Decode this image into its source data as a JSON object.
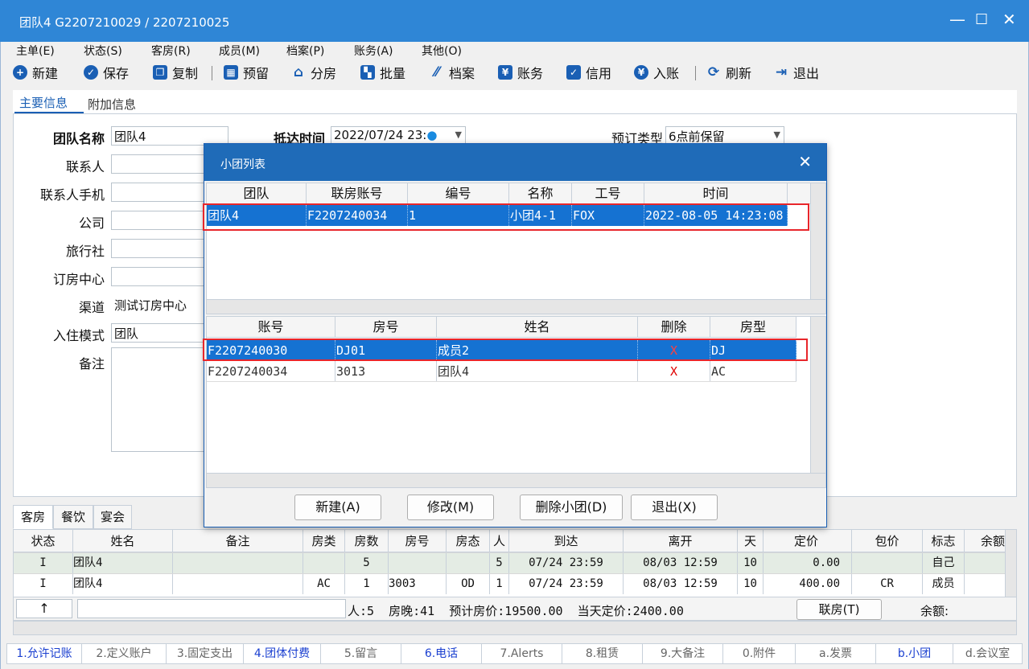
{
  "window": {
    "title": "团队4 G2207210029 / 2207210025",
    "controls": [
      "—",
      "☐",
      "✕"
    ]
  },
  "menu": [
    "主单(E)",
    "状态(S)",
    "客房(R)",
    "成员(M)",
    "档案(P)",
    "账务(A)",
    "其他(O)"
  ],
  "toolbar": {
    "new": "新建",
    "save": "保存",
    "copy": "复制",
    "reserve": "预留",
    "assign": "分房",
    "batch": "批量",
    "profile": "档案",
    "accounts": "账务",
    "credit": "信用",
    "post": "入账",
    "refresh": "刷新",
    "exit": "退出"
  },
  "tabs": {
    "main": "主要信息",
    "extra": "附加信息"
  },
  "form": {
    "group_name_label": "团队名称",
    "group_name": "团队4",
    "arrival_label": "抵达时间",
    "arrival": "2022/07/24 23:",
    "booking_type_label": "预订类型",
    "booking_type": "6点前保留",
    "contact_label": "联系人",
    "contact": "",
    "contact_phone_label": "联系人手机",
    "contact_phone": "",
    "company_label": "公司",
    "company": "",
    "agency_label": "旅行社",
    "agency": "",
    "booking_center_label": "订房中心",
    "booking_center": "",
    "channel_label": "渠道",
    "channel": "测试订房中心",
    "checkin_mode_label": "入住模式",
    "checkin_mode": "团队",
    "remark_label": "备注",
    "remark": ""
  },
  "dialog": {
    "title": "小团列表",
    "close": "✕",
    "top_headers": [
      "团队",
      "联房账号",
      "编号",
      "名称",
      "工号",
      "时间"
    ],
    "top_rows": [
      {
        "group": "团队4",
        "linked_account": "F2207240034",
        "number": "1",
        "name": "小团4-1",
        "staff_id": "FOX",
        "time": "2022-08-05 14:23:08"
      }
    ],
    "bottom_headers": [
      "账号",
      "房号",
      "姓名",
      "删除",
      "房型"
    ],
    "bottom_rows": [
      {
        "account": "F2207240030",
        "room": "DJ01",
        "name": "成员2",
        "delete": "X",
        "room_type": "DJ"
      },
      {
        "account": "F2207240034",
        "room": "3013",
        "name": "团队4",
        "delete": "X",
        "room_type": "AC"
      }
    ],
    "buttons": {
      "new": "新建(A)",
      "edit": "修改(M)",
      "delete": "删除小团(D)",
      "exit": "退出(X)"
    }
  },
  "bottom_tabs": [
    "客房",
    "餐饮",
    "宴会"
  ],
  "room_grid": {
    "headers": [
      "状态",
      "姓名",
      "备注",
      "房类",
      "房数",
      "房号",
      "房态",
      "人",
      "到达",
      "离开",
      "天",
      "定价",
      "包价",
      "标志",
      "余额"
    ],
    "rows": [
      [
        "I",
        "团队4",
        "",
        "",
        "5",
        "",
        "",
        "5",
        "07/24 23:59",
        "08/03 12:59",
        "10",
        "0.00",
        "",
        "自己",
        ""
      ],
      [
        "I",
        "团队4",
        "",
        "AC",
        "1",
        "3003",
        "OD",
        "1",
        "07/24 23:59",
        "08/03 12:59",
        "10",
        "400.00",
        "CR",
        "成员",
        ""
      ]
    ]
  },
  "summary": {
    "arrow": "↑",
    "text": "人:5  房晚:41  预计房价:19500.00  当天定价:2400.00",
    "linked_room_button": "联房(T)",
    "balance_label": "余额:"
  },
  "bottom_bar": [
    "1.允许记账",
    "2.定义账户",
    "3.固定支出",
    "4.团体付费",
    "5.留言",
    "6.电话",
    "7.Alerts",
    "8.租赁",
    "9.大备注",
    "0.附件",
    "a.发票",
    "b.小团",
    "d.会议室"
  ]
}
